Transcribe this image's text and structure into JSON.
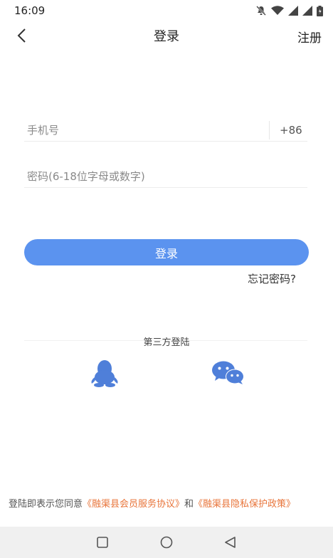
{
  "status_bar": {
    "time": "16:09",
    "icons": [
      "notification-off-icon",
      "wifi-icon",
      "signal-icon",
      "signal-icon",
      "battery-icon"
    ]
  },
  "header": {
    "back_icon": "chevron-left-icon",
    "title": "登录",
    "register_label": "注册"
  },
  "form": {
    "phone_placeholder": "手机号",
    "phone_value": "",
    "country_code": "+86",
    "password_placeholder": "密码(6-18位字母或数字)",
    "password_value": "",
    "login_button": "登录",
    "forgot_password": "忘记密码?"
  },
  "third_party": {
    "title": "第三方登陆",
    "options": [
      {
        "name": "qq",
        "icon": "qq-icon"
      },
      {
        "name": "wechat",
        "icon": "wechat-icon"
      }
    ]
  },
  "agreement": {
    "prefix": "登陆即表示您同意",
    "link1": "《融渠县会员服务协议》",
    "middle": "和",
    "link2": "《融渠县隐私保护政策》"
  },
  "colors": {
    "accent": "#5b93ef",
    "link": "#e8743a"
  },
  "nav_bar": {
    "buttons": [
      "recents-square-icon",
      "home-circle-icon",
      "back-triangle-icon"
    ]
  }
}
